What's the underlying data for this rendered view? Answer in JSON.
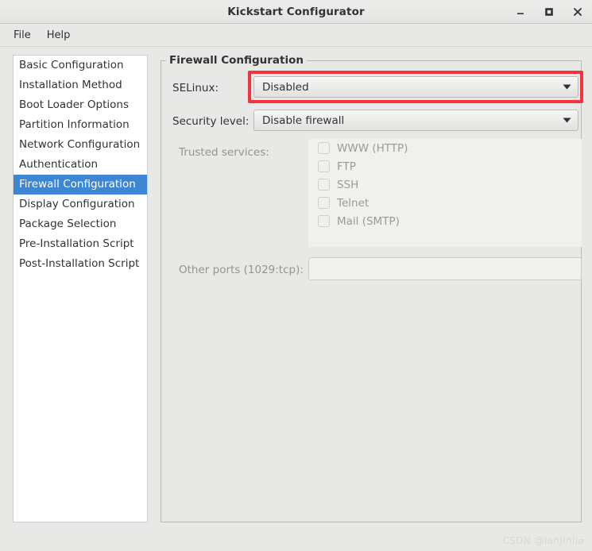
{
  "window": {
    "title": "Kickstart Configurator",
    "controls": [
      {
        "name": "minimize",
        "glyph": "minimize-icon"
      },
      {
        "name": "maximize",
        "glyph": "maximize-icon"
      },
      {
        "name": "close",
        "glyph": "close-icon"
      }
    ]
  },
  "menubar": {
    "items": [
      {
        "label": "File"
      },
      {
        "label": "Help"
      }
    ]
  },
  "sidebar": {
    "items": [
      {
        "label": "Basic Configuration",
        "selected": false
      },
      {
        "label": "Installation Method",
        "selected": false
      },
      {
        "label": "Boot Loader Options",
        "selected": false
      },
      {
        "label": "Partition Information",
        "selected": false
      },
      {
        "label": "Network Configuration",
        "selected": false
      },
      {
        "label": "Authentication",
        "selected": false
      },
      {
        "label": "Firewall Configuration",
        "selected": true
      },
      {
        "label": "Display Configuration",
        "selected": false
      },
      {
        "label": "Package Selection",
        "selected": false
      },
      {
        "label": "Pre-Installation Script",
        "selected": false
      },
      {
        "label": "Post-Installation Script",
        "selected": false
      }
    ]
  },
  "panel": {
    "group_title": "Firewall Configuration",
    "selinux": {
      "label": "SELinux:",
      "value": "Disabled",
      "highlighted": true,
      "highlight_color": "#f4333d"
    },
    "security_level": {
      "label": "Security level:",
      "value": "Disable firewall"
    },
    "trusted_services": {
      "label": "Trusted services:",
      "disabled": true,
      "items": [
        {
          "label": "WWW (HTTP)",
          "checked": false
        },
        {
          "label": "FTP",
          "checked": false
        },
        {
          "label": "SSH",
          "checked": false
        },
        {
          "label": "Telnet",
          "checked": false
        },
        {
          "label": "Mail (SMTP)",
          "checked": false
        }
      ]
    },
    "other_ports": {
      "label": "Other ports (1029:tcp):",
      "value": "",
      "placeholder": "",
      "disabled": true
    }
  },
  "watermark": {
    "text": "CSDN @lanjinli⌀"
  },
  "colors": {
    "selection": "#3d86d4",
    "highlight": "#f4333d",
    "window_bg": "#e8e8e7",
    "text": "#2e3436",
    "disabled_text": "#9a9a96"
  }
}
